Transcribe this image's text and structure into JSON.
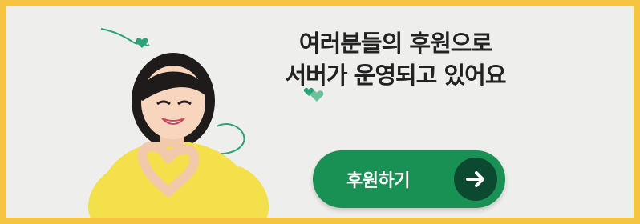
{
  "banner": {
    "headline_line1": "여러분들의 후원으로",
    "headline_line2": "서버가 운영되고 있어요",
    "cta_label": "후원하기",
    "cta_icon": "arrow-right-icon"
  },
  "colors": {
    "frame": "#f5c542",
    "background": "#eeeeec",
    "cta_background": "#1a9154",
    "cta_icon_background": "#0b4a30",
    "accent_line": "#2aa37a"
  }
}
